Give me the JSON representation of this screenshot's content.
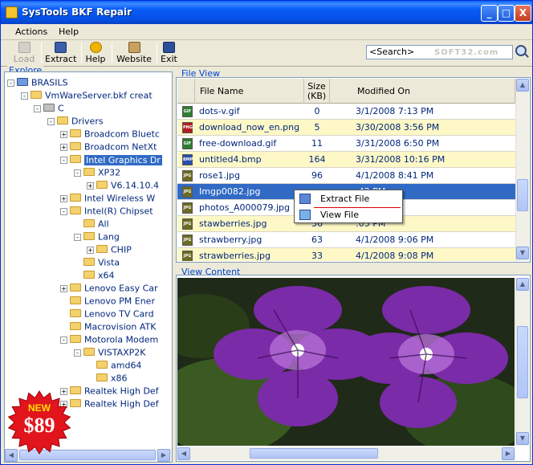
{
  "window": {
    "title": "SysTools BKF Repair",
    "controls": [
      "_",
      "□",
      "X"
    ]
  },
  "menu": [
    "Actions",
    "Help"
  ],
  "toolbar": [
    {
      "label": "Load",
      "icon": "load-icon"
    },
    {
      "label": "Extract",
      "icon": "extract-icon"
    },
    {
      "label": "Help",
      "icon": "help-icon"
    },
    {
      "label": "Website",
      "icon": "website-icon"
    },
    {
      "label": "Exit",
      "icon": "exit-icon"
    }
  ],
  "search": {
    "value": "<Search>"
  },
  "watermark": "SOFT32.com",
  "explore": {
    "label": "Explore",
    "nodes": [
      {
        "text": "BRASILS",
        "exp": "-",
        "icon": "computer"
      },
      {
        "text": "VmWareServer.bkf creat",
        "exp": "-",
        "icon": "folder"
      },
      {
        "text": "C",
        "exp": "-",
        "icon": "drive"
      },
      {
        "text": "Drivers",
        "exp": "-",
        "icon": "folder"
      },
      {
        "text": "Broadcom Bluetc",
        "exp": "+",
        "icon": "folder"
      },
      {
        "text": "Broadcom NetXt",
        "exp": "+",
        "icon": "folder"
      },
      {
        "text": "Intel Graphics Dr",
        "exp": "-",
        "icon": "folder",
        "selected": true
      },
      {
        "text": "XP32",
        "exp": "-",
        "icon": "folder"
      },
      {
        "text": "V6.14.10.4",
        "exp": "+",
        "icon": "folder"
      },
      {
        "text": "Intel Wireless W",
        "exp": "+",
        "icon": "folder"
      },
      {
        "text": "Intel(R) Chipset",
        "exp": "-",
        "icon": "folder"
      },
      {
        "text": "All",
        "exp": "",
        "icon": "folder"
      },
      {
        "text": "Lang",
        "exp": "-",
        "icon": "folder"
      },
      {
        "text": "CHIP",
        "exp": "+",
        "icon": "folder"
      },
      {
        "text": "Vista",
        "exp": "",
        "icon": "folder"
      },
      {
        "text": "x64",
        "exp": "",
        "icon": "folder"
      },
      {
        "text": "Lenovo Easy Car",
        "exp": "+",
        "icon": "folder"
      },
      {
        "text": "Lenovo PM Ener",
        "exp": "",
        "icon": "folder"
      },
      {
        "text": "Lenovo TV Card",
        "exp": "",
        "icon": "folder"
      },
      {
        "text": "Macrovision ATK",
        "exp": "",
        "icon": "folder"
      },
      {
        "text": "Motorola Modem",
        "exp": "-",
        "icon": "folder"
      },
      {
        "text": "VISTAXP2K",
        "exp": "-",
        "icon": "folder"
      },
      {
        "text": "amd64",
        "exp": "",
        "icon": "folder"
      },
      {
        "text": "x86",
        "exp": "",
        "icon": "folder"
      },
      {
        "text": "Realtek High Def",
        "exp": "+",
        "icon": "folder"
      },
      {
        "text": "Realtek High Def",
        "exp": "+",
        "icon": "folder"
      }
    ]
  },
  "fileview": {
    "label": "File View",
    "columns": [
      "File Name",
      "Size\n(KB)",
      "Modified On"
    ],
    "rows": [
      {
        "name": "dots-v.gif",
        "size": "0",
        "date": "3/1/2008 7:13 PM",
        "type": "GIF"
      },
      {
        "name": "download_now_en.png",
        "size": "5",
        "date": "3/30/2008 3:56 PM",
        "type": "PNG"
      },
      {
        "name": "free-download.gif",
        "size": "11",
        "date": "3/31/2008 6:50 PM",
        "type": "GIF"
      },
      {
        "name": "untitled4.bmp",
        "size": "164",
        "date": "3/31/2008 10:16 PM",
        "type": "BMP"
      },
      {
        "name": "rose1.jpg",
        "size": "96",
        "date": "4/1/2008 8:41 PM",
        "type": "JPG"
      },
      {
        "name": "Imgp0082.jpg",
        "size": "",
        "date": ":42 PM",
        "type": "JPG",
        "highlight": true
      },
      {
        "name": "photos_A000079.jpg",
        "size": "",
        "date": ":02 PM",
        "type": "JPG"
      },
      {
        "name": "stawberries.jpg",
        "size": "36",
        "date": ":05 PM",
        "type": "JPG"
      },
      {
        "name": "strawberry.jpg",
        "size": "63",
        "date": "4/1/2008 9:06 PM",
        "type": "JPG"
      },
      {
        "name": "strawberries.jpg",
        "size": "33",
        "date": "4/1/2008 9:08 PM",
        "type": "JPG"
      }
    ]
  },
  "context_menu": {
    "extract": "Extract File",
    "view": "View File"
  },
  "viewcontent": {
    "label": "View Content"
  },
  "promo": {
    "new": "NEW",
    "price": "$89"
  },
  "colors": {
    "title": "#0a5ef7",
    "selection": "#316ac5",
    "alt_row": "#fdf8c6",
    "link": "#00267c"
  }
}
